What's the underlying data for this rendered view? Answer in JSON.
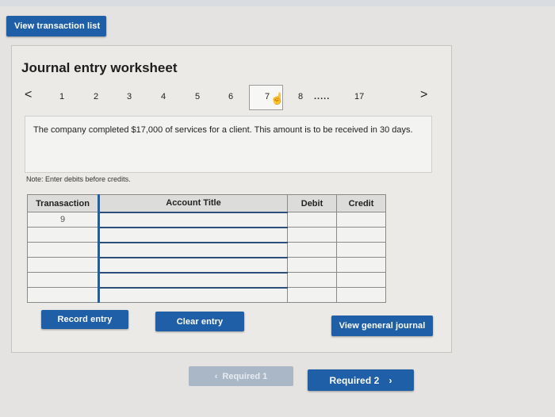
{
  "toolbar": {
    "view_transaction_list": "View transaction list"
  },
  "worksheet": {
    "title": "Journal entry worksheet",
    "pager": {
      "prev": "<",
      "pages": [
        "1",
        "2",
        "3",
        "4",
        "5",
        "6",
        "7",
        "8"
      ],
      "active": "7",
      "ellipsis": ".....",
      "last": "17",
      "next": ">"
    },
    "description": "The company completed $17,000 of services for a client. This amount is to be received in 30 days.",
    "note": "Note: Enter debits before credits.",
    "table": {
      "headers": [
        "Tranasaction",
        "Account Title",
        "Debit",
        "Credit"
      ],
      "first_transaction": "9",
      "rows": 6
    },
    "buttons": {
      "record": "Record entry",
      "clear": "Clear entry",
      "view_general": "View general journal"
    }
  },
  "nav": {
    "prev_label": "Required 1",
    "prev_icon": "chevron-left-icon",
    "next_label": "Required 2",
    "next_icon": "chevron-right-icon"
  },
  "colors": {
    "accent": "#1f5fa8",
    "disabled": "#aab7c6",
    "panel_bg": "#ebeae7"
  }
}
